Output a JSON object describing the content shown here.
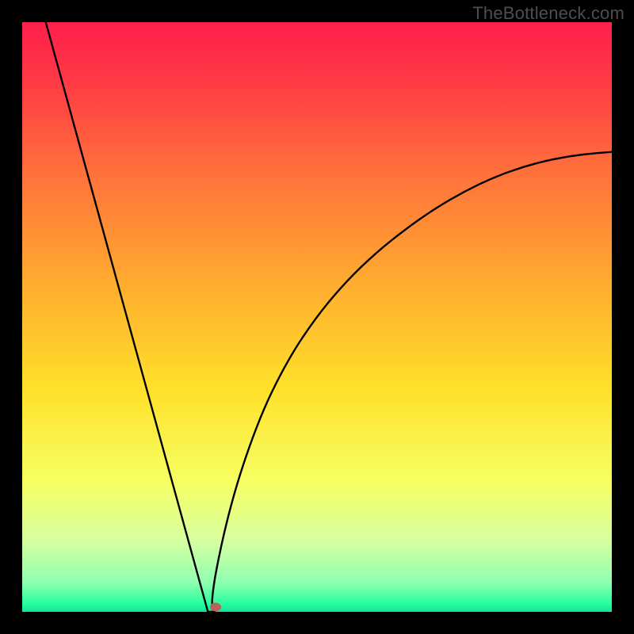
{
  "watermark": "TheBottleneck.com",
  "chart_data": {
    "type": "line",
    "title": "",
    "xlabel": "",
    "ylabel": "",
    "xlim": [
      0,
      1
    ],
    "ylim": [
      0,
      1
    ],
    "curve": {
      "name": "bottleneck-curve",
      "vertex_x": 0.315,
      "left": {
        "x_start": 0.04,
        "y_start": 1.0
      },
      "right": {
        "x_end": 1.0,
        "y_end": 0.78
      },
      "samples_left": [
        {
          "x": 0.04,
          "y": 1.0
        },
        {
          "x": 0.08,
          "y": 0.855
        },
        {
          "x": 0.12,
          "y": 0.709
        },
        {
          "x": 0.16,
          "y": 0.564
        },
        {
          "x": 0.2,
          "y": 0.418
        },
        {
          "x": 0.24,
          "y": 0.273
        },
        {
          "x": 0.28,
          "y": 0.127
        },
        {
          "x": 0.315,
          "y": 0.0
        }
      ],
      "samples_right": [
        {
          "x": 0.315,
          "y": 0.0
        },
        {
          "x": 0.35,
          "y": 0.174
        },
        {
          "x": 0.4,
          "y": 0.325
        },
        {
          "x": 0.45,
          "y": 0.427
        },
        {
          "x": 0.5,
          "y": 0.502
        },
        {
          "x": 0.55,
          "y": 0.561
        },
        {
          "x": 0.6,
          "y": 0.609
        },
        {
          "x": 0.65,
          "y": 0.649
        },
        {
          "x": 0.7,
          "y": 0.684
        },
        {
          "x": 0.75,
          "y": 0.713
        },
        {
          "x": 0.8,
          "y": 0.737
        },
        {
          "x": 0.85,
          "y": 0.755
        },
        {
          "x": 0.9,
          "y": 0.768
        },
        {
          "x": 0.95,
          "y": 0.776
        },
        {
          "x": 1.0,
          "y": 0.78
        }
      ]
    },
    "marker": {
      "x": 0.328,
      "y": 0.008,
      "color": "#b9615c"
    },
    "gradient_stops": [
      {
        "offset": 0.0,
        "color": "#ff1f4b"
      },
      {
        "offset": 0.1,
        "color": "#ff3a45"
      },
      {
        "offset": 0.25,
        "color": "#ff6f3b"
      },
      {
        "offset": 0.45,
        "color": "#ffae2f"
      },
      {
        "offset": 0.62,
        "color": "#ffe029"
      },
      {
        "offset": 0.78,
        "color": "#f6ff63"
      },
      {
        "offset": 0.88,
        "color": "#d6ffa0"
      },
      {
        "offset": 0.95,
        "color": "#8effb0"
      },
      {
        "offset": 0.985,
        "color": "#2bff9e"
      },
      {
        "offset": 1.0,
        "color": "#10e59a"
      }
    ]
  }
}
